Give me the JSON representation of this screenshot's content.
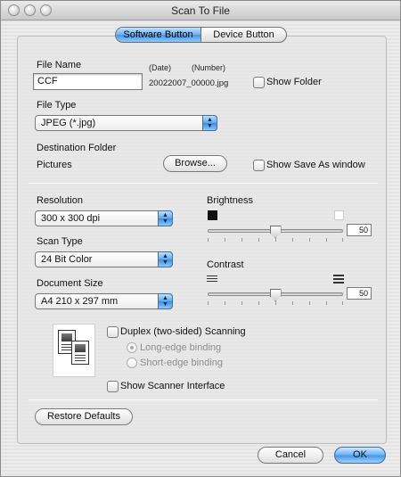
{
  "window": {
    "title": "Scan To File"
  },
  "tabs": [
    {
      "label": "Software Button",
      "active": true
    },
    {
      "label": "Device Button",
      "active": false
    }
  ],
  "file_name": {
    "label": "File Name",
    "value": "CCF",
    "date_header": "(Date)",
    "number_header": "(Number)",
    "generated_suffix": "20022007_00000.jpg",
    "show_folder_label": "Show Folder"
  },
  "file_type": {
    "label": "File Type",
    "selected": "JPEG (*.jpg)"
  },
  "destination": {
    "label": "Destination Folder",
    "folder": "Pictures",
    "browse_label": "Browse...",
    "show_save_as_label": "Show Save As window"
  },
  "resolution": {
    "label": "Resolution",
    "selected": "300 x 300 dpi"
  },
  "scan_type": {
    "label": "Scan Type",
    "selected": "24 Bit Color"
  },
  "document_size": {
    "label": "Document Size",
    "selected": "A4  210 x 297 mm"
  },
  "brightness": {
    "label": "Brightness",
    "value": "50",
    "level": 0.5
  },
  "contrast": {
    "label": "Contrast",
    "value": "50",
    "level": 0.5
  },
  "duplex": {
    "label": "Duplex (two-sided) Scanning",
    "long_edge": "Long-edge binding",
    "short_edge": "Short-edge binding"
  },
  "scanner_interface": {
    "label": "Show Scanner Interface"
  },
  "buttons": {
    "restore_defaults": "Restore Defaults",
    "cancel": "Cancel",
    "ok": "OK"
  }
}
